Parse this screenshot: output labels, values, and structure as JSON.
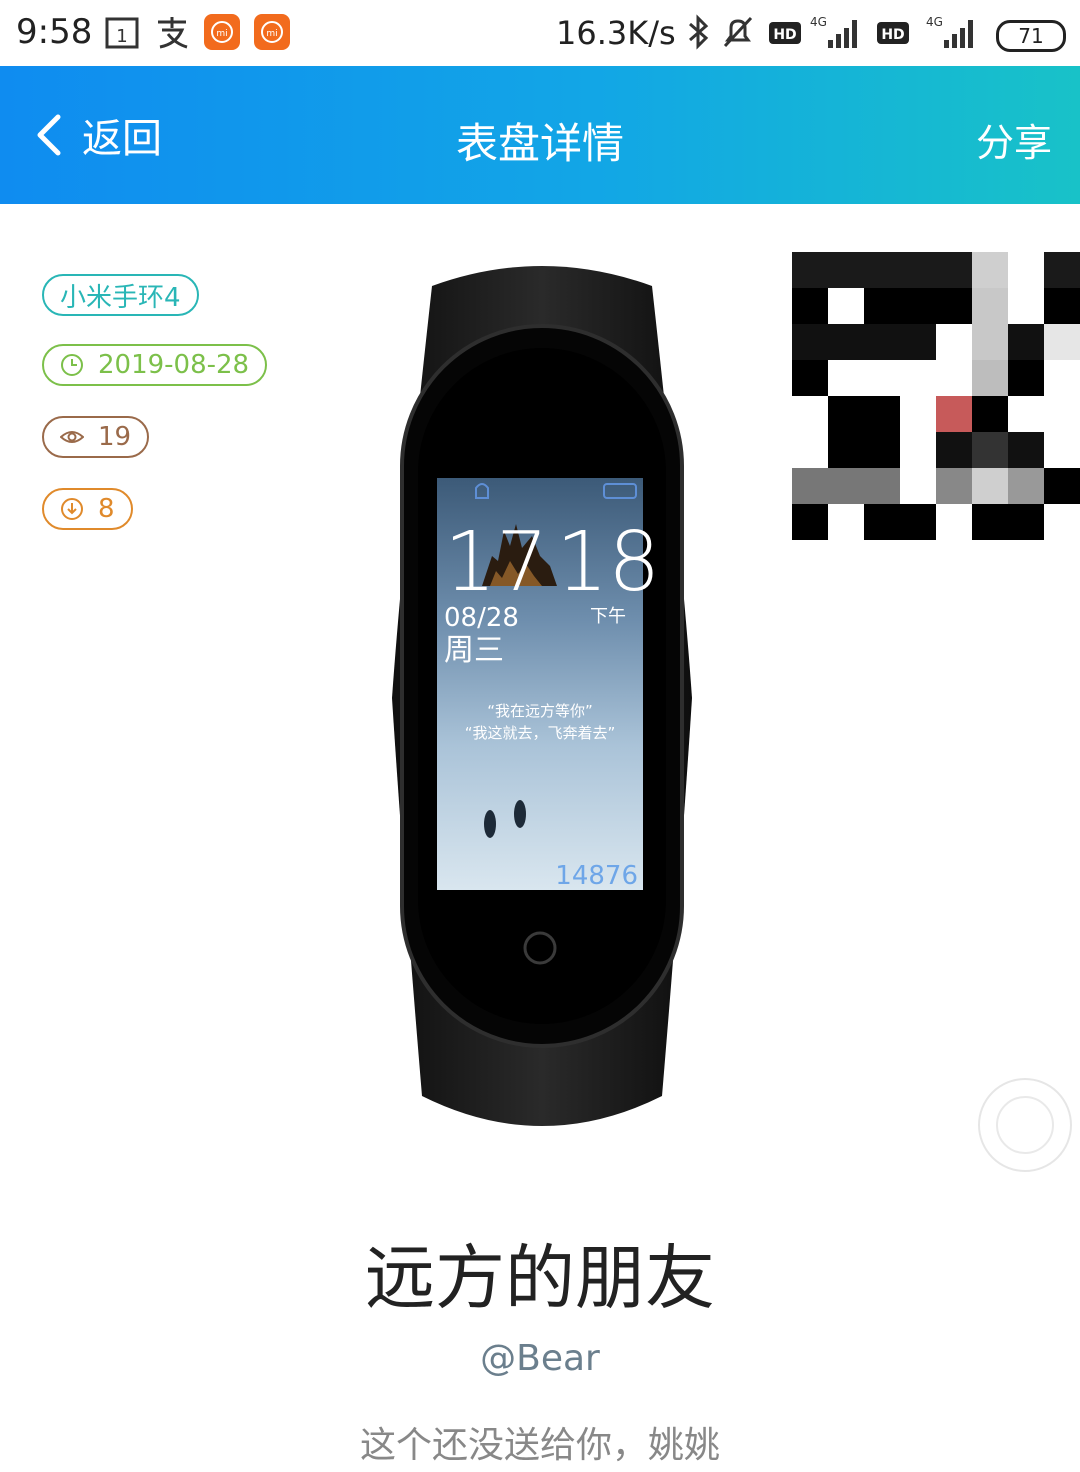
{
  "status_bar": {
    "time": "9:58",
    "speed": "16.3K/s",
    "battery": "71",
    "icons": [
      "calendar-icon",
      "alipay-icon",
      "mi-app-icon",
      "mi-app-icon",
      "bluetooth-icon",
      "mute-icon",
      "hd-icon",
      "signal-4g-icon",
      "hd-icon",
      "signal-4g-icon",
      "battery-icon"
    ]
  },
  "header": {
    "back_label": "返回",
    "title": "表盘详情",
    "share_label": "分享",
    "colors": {
      "start": "#0f8cf0",
      "end": "#18c2c8"
    }
  },
  "tags": {
    "device": "小米手环4",
    "date": "2019-08-28",
    "views": "19",
    "downloads": "8",
    "colors": {
      "device": "#29b6b6",
      "date": "#7cc04a",
      "views": "#9a6a4a",
      "downloads": "#e08a2b"
    }
  },
  "watch_face": {
    "time_hour": "17",
    "time_minute": "18",
    "date": "08/28",
    "weekday": "周三",
    "ampm": "下午",
    "quote_1": "“我在远方等你”",
    "quote_2": "“我这就去，飞奔着去”",
    "steps": "14876"
  },
  "detail": {
    "name": "远方的朋友",
    "author": "@Bear",
    "description": "这个还没送给你，姚姚"
  }
}
